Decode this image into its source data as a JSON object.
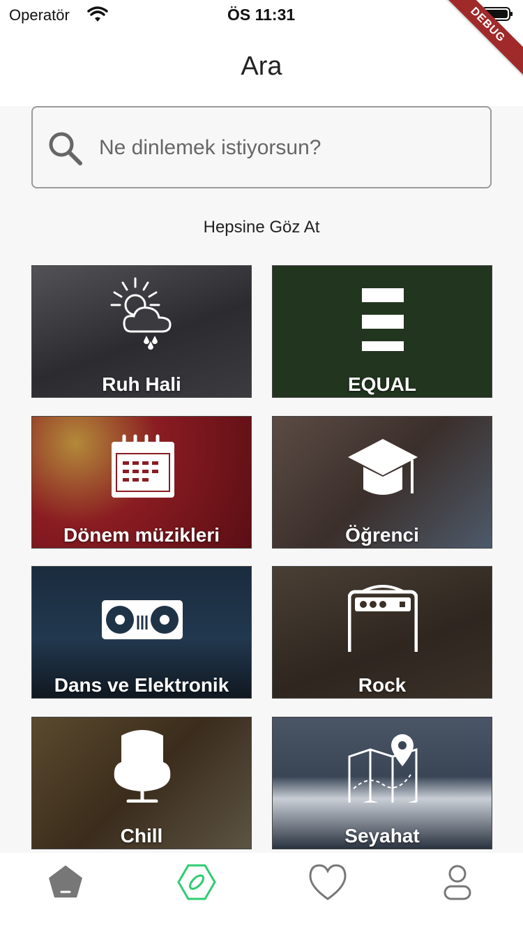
{
  "status_bar": {
    "carrier": "Operatör",
    "time": "ÖS 11:31",
    "debug_label": "DEBUG"
  },
  "header": {
    "title": "Ara"
  },
  "search": {
    "placeholder": "Ne dinlemek istiyorsun?"
  },
  "browse": {
    "title": "Hepsine Göz At",
    "categories": [
      {
        "label": "Ruh Hali",
        "icon": "weather-sun-cloud-rain-icon",
        "bg": "#3a3a3f"
      },
      {
        "label": "EQUAL",
        "icon": "equal-bars-icon",
        "bg": "#22351f"
      },
      {
        "label": "Dönem müzikleri",
        "icon": "calendar-icon",
        "bg": "#8a1c22"
      },
      {
        "label": "Öğrenci",
        "icon": "graduation-cap-icon",
        "bg": "#4a3b36"
      },
      {
        "label": "Dans ve Elektronik",
        "icon": "turntable-icon",
        "bg": "#1f3346"
      },
      {
        "label": "Rock",
        "icon": "amplifier-icon",
        "bg": "#3b3129"
      },
      {
        "label": "Chill",
        "icon": "egg-chair-icon",
        "bg": "#3b2c1c"
      },
      {
        "label": "Seyahat",
        "icon": "map-pin-icon",
        "bg": "#3a4656"
      }
    ]
  },
  "bottom_nav": {
    "items": [
      {
        "name": "home",
        "icon": "home-pentagon-icon",
        "active": false
      },
      {
        "name": "search",
        "icon": "compass-hexagon-icon",
        "active": true
      },
      {
        "name": "favorites",
        "icon": "heart-icon",
        "active": false
      },
      {
        "name": "profile",
        "icon": "profile-icon",
        "active": false
      }
    ],
    "active_color": "#2ecc71",
    "inactive_color": "#777777"
  }
}
